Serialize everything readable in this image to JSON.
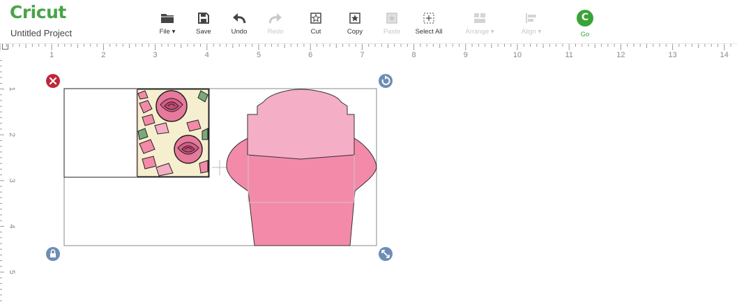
{
  "app": {
    "logo_text": "Cricut",
    "project_title": "Untitled Project"
  },
  "toolbar": {
    "file": "File",
    "save": "Save",
    "undo": "Undo",
    "redo": "Redo",
    "cut": "Cut",
    "copy": "Copy",
    "paste": "Paste",
    "select_all": "Select All",
    "arrange": "Arrange",
    "align": "Align",
    "go": "Go",
    "go_glyph": "C"
  },
  "ruler": {
    "horizontal": [
      "1",
      "2",
      "3",
      "4",
      "5",
      "6",
      "7",
      "8",
      "9",
      "10",
      "11",
      "12",
      "13",
      "14"
    ],
    "vertical": [
      "1",
      "2",
      "3",
      "4",
      "5"
    ]
  },
  "colors": {
    "brand": "#4aa34a",
    "go": "#3aa335",
    "delete_handle": "#c0273a",
    "handle": "#6e8db5",
    "envelope_top": "#f4aec6",
    "envelope_body": "#f48aa9",
    "bounding_box": "#888888"
  },
  "icons": {
    "file": "folder-icon",
    "save": "floppy-disk-icon",
    "undo": "undo-arrow-icon",
    "redo": "redo-arrow-icon",
    "cut": "cut-icon",
    "copy": "copy-icon",
    "paste": "paste-icon",
    "select_all": "select-all-icon",
    "arrange": "arrange-icon",
    "align": "align-icon",
    "delete": "close-icon",
    "rotate": "rotate-icon",
    "lock": "lock-icon",
    "resize": "resize-icon"
  }
}
